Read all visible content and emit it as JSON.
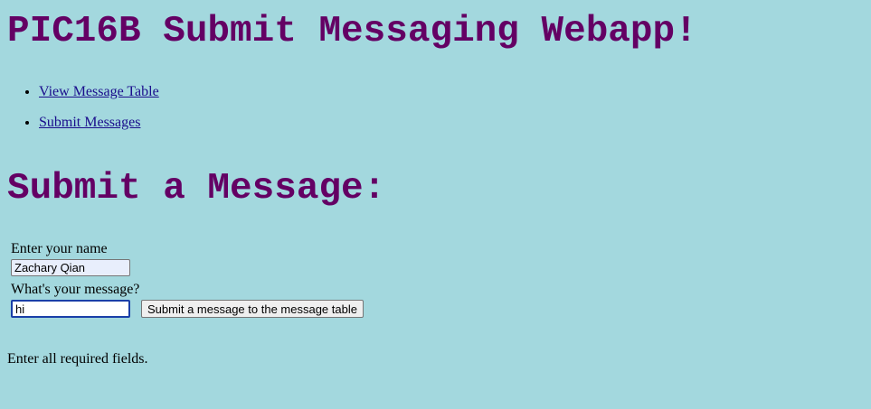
{
  "header": {
    "title": "PIC16B Submit Messaging Webapp!"
  },
  "nav": {
    "items": [
      {
        "label": "View Message Table"
      },
      {
        "label": "Submit Messages"
      }
    ]
  },
  "main": {
    "heading": "Submit a Message:",
    "form": {
      "name_label": "Enter your name",
      "name_value": "Zachary Qian",
      "message_label": "What's your message?",
      "message_value": "hi",
      "submit_label": "Submit a message to the message table"
    },
    "status_text": "Enter all required fields."
  },
  "colors": {
    "background": "#a3d8de",
    "heading": "#640064",
    "link": "#1a0d8c"
  }
}
